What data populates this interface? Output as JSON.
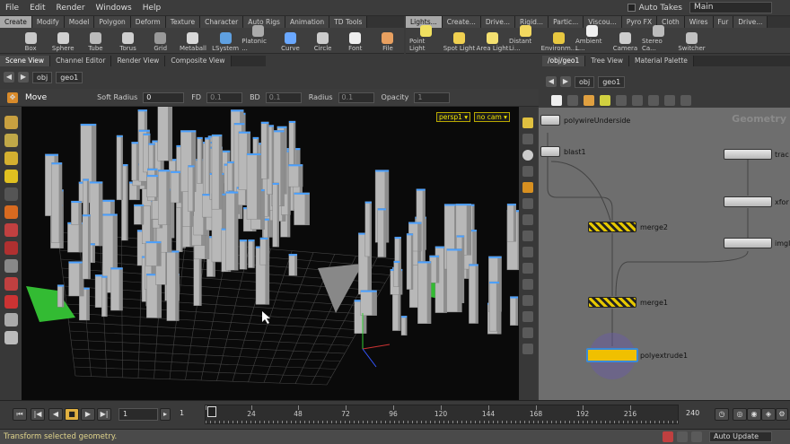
{
  "menu": [
    "File",
    "Edit",
    "Render",
    "Windows",
    "Help"
  ],
  "header": {
    "auto_takes": "Auto Takes",
    "desktop": "Main"
  },
  "shelf_left": [
    "Create",
    "Modify",
    "Model",
    "Polygon",
    "Deform",
    "Texture",
    "Character",
    "Auto Rigs",
    "Animation",
    "TD Tools"
  ],
  "shelf_right": [
    "Lights...",
    "Create...",
    "Drive...",
    "Rigid...",
    "Partic...",
    "Viscou...",
    "Pyro FX",
    "Cloth",
    "Wires",
    "Fur",
    "Drive..."
  ],
  "tools_left": [
    {
      "label": "Box",
      "icon": "box-icon",
      "color": "#c8c8c8"
    },
    {
      "label": "Sphere",
      "icon": "sphere-icon",
      "color": "#d0d0d0"
    },
    {
      "label": "Tube",
      "icon": "tube-icon",
      "color": "#bbbbbb"
    },
    {
      "label": "Torus",
      "icon": "torus-icon",
      "color": "#cfcfcf"
    },
    {
      "label": "Grid",
      "icon": "grid-icon",
      "color": "#999999"
    },
    {
      "label": "Metaball",
      "icon": "metaball-icon",
      "color": "#d8d8d8"
    },
    {
      "label": "LSystem",
      "icon": "lsystem-icon",
      "color": "#5fa0e0"
    },
    {
      "label": "Platonic ...",
      "icon": "platonic-icon",
      "color": "#aaaaaa"
    },
    {
      "label": "Curve",
      "icon": "curve-icon",
      "color": "#6aa8ff"
    },
    {
      "label": "Circle",
      "icon": "circle-icon",
      "color": "#cccccc"
    },
    {
      "label": "Font",
      "icon": "font-icon",
      "color": "#eeeeee"
    },
    {
      "label": "File",
      "icon": "file-icon",
      "color": "#e8a060"
    }
  ],
  "tools_right": [
    {
      "label": "Point Light",
      "icon": "point-light-icon",
      "color": "#f0e060"
    },
    {
      "label": "Spot Light",
      "icon": "spot-light-icon",
      "color": "#f0d050"
    },
    {
      "label": "Area Light",
      "icon": "area-light-icon",
      "color": "#f4e070"
    },
    {
      "label": "Distant Li...",
      "icon": "distant-light-icon",
      "color": "#f2d860"
    },
    {
      "label": "Environm...",
      "icon": "environment-light-icon",
      "color": "#e8c840"
    },
    {
      "label": "Ambient L...",
      "icon": "ambient-light-icon",
      "color": "#f0f0f0"
    },
    {
      "label": "Camera",
      "icon": "camera-icon",
      "color": "#cccccc"
    },
    {
      "label": "Stereo Ca...",
      "icon": "stereo-camera-icon",
      "color": "#bbbbbb"
    },
    {
      "label": "Switcher",
      "icon": "switcher-icon",
      "color": "#c0c0c0"
    }
  ],
  "left_tabs": [
    "Scene View",
    "Channel Editor",
    "Render View",
    "Composite View"
  ],
  "right_tabs": [
    "/obj/geo1",
    "Tree View",
    "Material Palette"
  ],
  "left_path": {
    "root": "obj",
    "node": "geo1"
  },
  "right_path": {
    "root": "obj",
    "node": "geo1"
  },
  "operation": {
    "name": "Move",
    "soft_radius_label": "Soft Radius",
    "soft_radius_value": "0",
    "fd_label": "FD",
    "fd_value": "0.1",
    "bd_label": "BD",
    "bd_value": "0.1",
    "radius_label": "Radius",
    "radius_value": "0.1",
    "opacity_label": "Opacity",
    "opacity_value": "1"
  },
  "viewport": {
    "camera": "persp1 ▾",
    "cam_select": "no cam ▾"
  },
  "network": {
    "label": "Geometry",
    "nodes": [
      {
        "name": "polywireUnderside",
        "kind": "plain"
      },
      {
        "name": "blast1",
        "kind": "plain"
      },
      {
        "name": "merge2",
        "kind": "merge"
      },
      {
        "name": "merge1",
        "kind": "merge"
      },
      {
        "name": "polyextrude1",
        "kind": "selected"
      },
      {
        "name": "trac",
        "kind": "plain"
      },
      {
        "name": "xfor",
        "kind": "plain"
      },
      {
        "name": "imgl",
        "kind": "plain"
      }
    ]
  },
  "timeline": {
    "start": "1",
    "current": "1",
    "end": "240",
    "ticks": [
      "1",
      "24",
      "48",
      "72",
      "96",
      "120",
      "144",
      "168",
      "192",
      "216"
    ]
  },
  "status": {
    "message": "Transform selected geometry.",
    "auto_update": "Auto Update"
  }
}
